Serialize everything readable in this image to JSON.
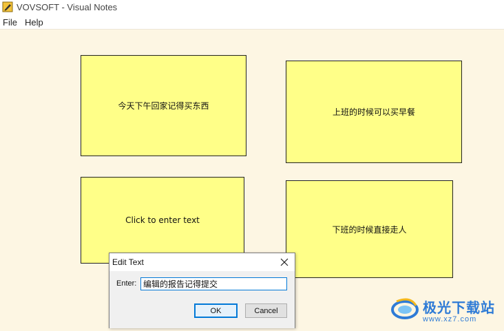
{
  "window": {
    "title": "VOVSOFT - Visual Notes"
  },
  "menu": {
    "items": [
      "File",
      "Help"
    ]
  },
  "notes": [
    {
      "text": "今天下午回家记得买东西"
    },
    {
      "text": "上班的时候可以买早餐"
    },
    {
      "text": "Click to enter text"
    },
    {
      "text": "下班的时候直接走人"
    }
  ],
  "dialog": {
    "title": "Edit Text",
    "label": "Enter:",
    "value": "编辑的报告记得提交",
    "ok_label": "OK",
    "cancel_label": "Cancel"
  },
  "watermark": {
    "brand": "极光下载站",
    "url": "www.xz7.com"
  },
  "colors": {
    "note_fill": "#ffff88",
    "canvas_bg": "#fdf6e3",
    "accent": "#0078d7",
    "watermark": "#2e7bd6"
  }
}
